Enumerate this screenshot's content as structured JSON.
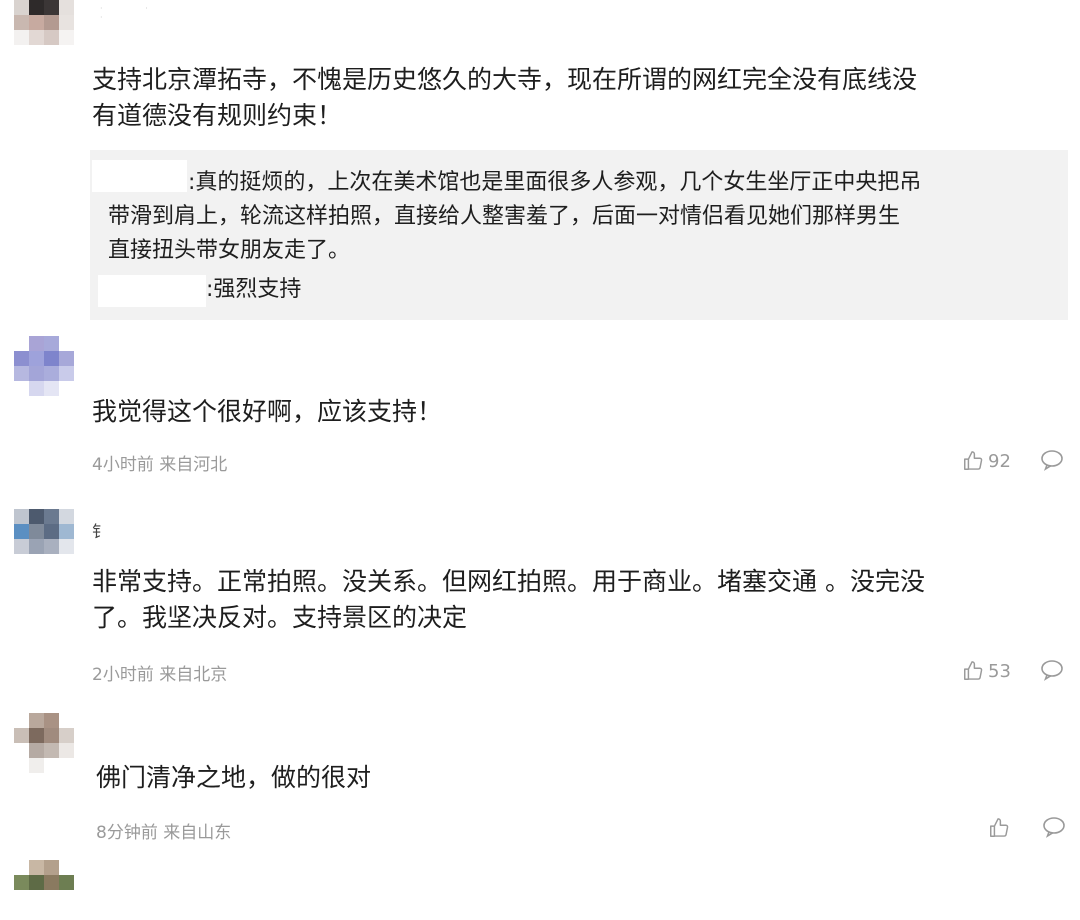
{
  "comments": [
    {
      "text_lines": [
        "支持北京潭拓寺，不愧是历史悠久的大寺，现在所谓的网红完全没有底线没",
        "有道德没有规则约束！"
      ],
      "replies": [
        {
          "lines": [
            ":真的挺烦的，上次在美术馆也是里面很多人参观，几个女生坐厅正中央把吊",
            "带滑到肩上，轮流这样拍照，直接给人整害羞了，后面一对情侣看见她们那样男生",
            "直接扭头带女朋友走了。"
          ]
        },
        {
          "lines": [
            ":强烈支持"
          ]
        }
      ]
    },
    {
      "text_lines": [
        "我觉得这个很好啊，应该支持！"
      ],
      "meta": "4小时前 来自河北",
      "likes": "92"
    },
    {
      "nickname_fragment": "钅",
      "text_lines": [
        "非常支持。正常拍照。没关系。但网红拍照。用于商业。堵塞交通 。没完没",
        "了。我坚决反对。支持景区的决定"
      ],
      "meta": "2小时前 来自北京",
      "likes": "53"
    },
    {
      "text_lines": [
        "佛门清净之地，做的很对"
      ],
      "meta": "8分钟前 来自山东",
      "likes": ""
    }
  ],
  "icons": {
    "like": "thumbs-up-icon",
    "reply": "comment-bubble-icon"
  },
  "colors": {
    "meta_gray": "#9a9a9a",
    "reply_bg": "#f2f2f2",
    "text": "#1e1e1e"
  }
}
